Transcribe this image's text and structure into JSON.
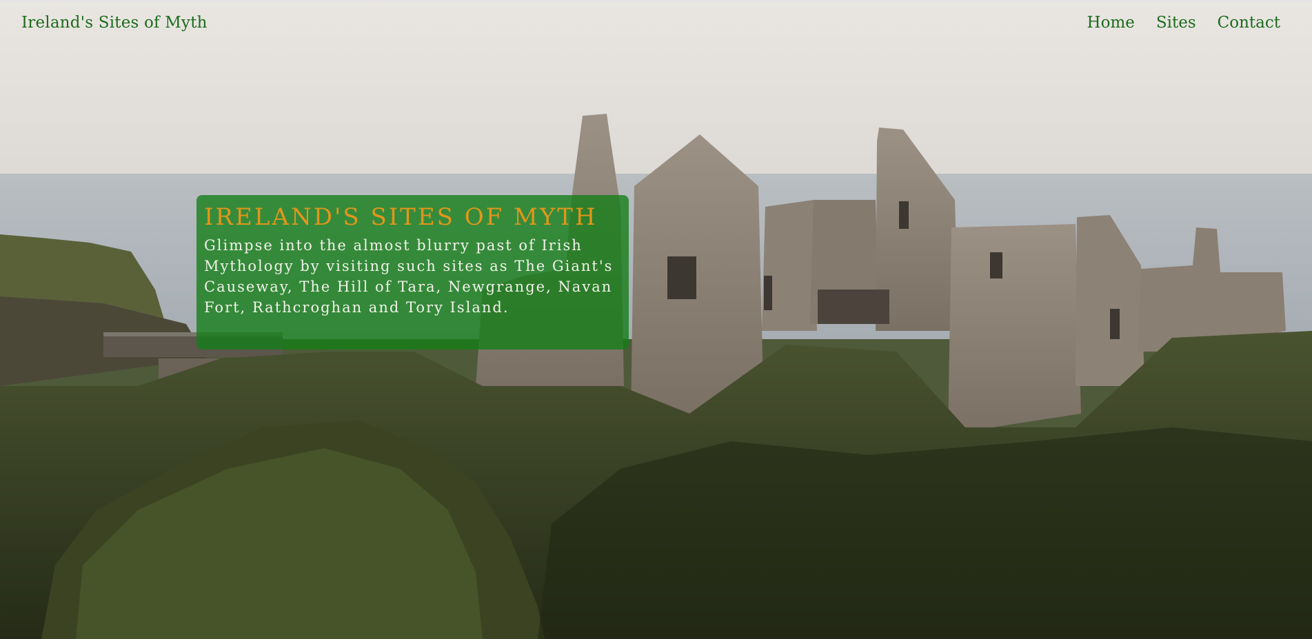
{
  "header": {
    "brand": "Ireland's Sites of Myth",
    "nav": [
      "Home",
      "Sites",
      "Contact"
    ]
  },
  "hero": {
    "image": "ruined-castle-on-cliff",
    "title": "Ireland's Sites of Myth",
    "description": "Glimpse into the almost blurry past of Irish Mythology by visiting such sites as The Giant's Causeway, The Hill of Tara, Newgrange, Navan Fort, Rathcroghan and Tory Island."
  },
  "colors": {
    "nav_text": "#1c6b1c",
    "box_background": "#127d16",
    "title_text": "#e2961a",
    "body_text": "#f2f2ea"
  }
}
